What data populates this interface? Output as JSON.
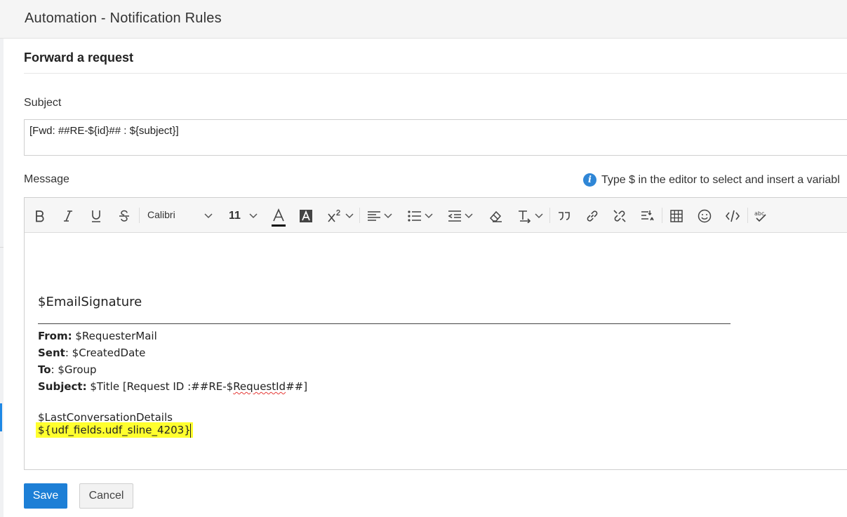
{
  "header": {
    "title": "Automation - Notification Rules"
  },
  "section": {
    "title": "Forward a request"
  },
  "subject": {
    "label": "Subject",
    "value": "[Fwd: ##RE-${id}## : ${subject}]"
  },
  "message": {
    "label": "Message",
    "hint": "Type $ in the editor to select and insert a variabl",
    "toolbar": {
      "font_name": "Calibri",
      "font_size": "11",
      "buttons": [
        "bold-icon",
        "italic-icon",
        "underline-icon",
        "strikethrough-icon",
        "font-family-dropdown",
        "font-size-dropdown",
        "font-color-icon",
        "highlight-color-icon",
        "superscript-icon",
        "align-icon",
        "bulleted-list-icon",
        "indent-icon",
        "clear-format-icon",
        "text-direction-icon",
        "quote-icon",
        "link-icon",
        "unlink-icon",
        "find-replace-icon",
        "table-icon",
        "emoji-icon",
        "insert-variable-icon",
        "spellcheck-icon"
      ]
    },
    "body": {
      "signature": "$EmailSignature",
      "from_label": "From:",
      "from_value": " $RequesterMail",
      "sent_label": "Sent",
      "sent_value": ": $CreatedDate",
      "to_label": "To",
      "to_value": ": $Group",
      "subject_label": "Subject:",
      "subject_value_pre": " $Title [Request ID :##RE-$",
      "subject_value_err": "RequestId",
      "subject_value_post": "##]",
      "last_conversation": "$LastConversationDetails",
      "udf_field": "${udf_fields.udf_sline_4203}"
    }
  },
  "actions": {
    "save": "Save",
    "cancel": "Cancel"
  },
  "colors": {
    "accent": "#1d7fd6",
    "highlight": "#ffff2e",
    "info": "#2f86d6"
  }
}
